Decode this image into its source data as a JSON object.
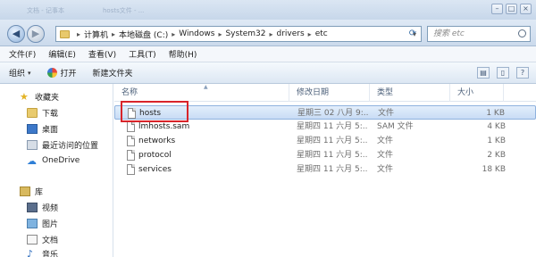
{
  "titlebar": {
    "ghost_tab_1": "文档 - 记事本",
    "ghost_tab_2": "hosts文件 - ...",
    "controls": [
      "–",
      "□",
      "×"
    ]
  },
  "address": {
    "back_icon": "back-arrow-icon",
    "forward_icon": "forward-arrow-icon",
    "crumbs": [
      "计算机",
      "本地磁盘 (C:)",
      "Windows",
      "System32",
      "drivers",
      "etc"
    ],
    "search_placeholder": "搜索 etc"
  },
  "menubar": {
    "items": [
      "文件(F)",
      "编辑(E)",
      "查看(V)",
      "工具(T)",
      "帮助(H)"
    ]
  },
  "toolbar": {
    "organize": "组织",
    "open": "打开",
    "new_folder": "新建文件夹"
  },
  "nav": {
    "favorites": "收藏夹",
    "downloads": "下载",
    "desktop": "桌面",
    "recent": "最近访问的位置",
    "onedrive": "OneDrive",
    "libraries": "库",
    "video": "视频",
    "pictures": "图片",
    "documents": "文档",
    "music": "音乐"
  },
  "columns": {
    "name": "名称",
    "modified": "修改日期",
    "type": "类型",
    "size": "大小"
  },
  "files": [
    {
      "name": "hosts",
      "modified": "星期三 02 八月 9:...",
      "type": "文件",
      "size": "1 KB"
    },
    {
      "name": "lmhosts.sam",
      "modified": "星期四 11 六月 5:...",
      "type": "SAM 文件",
      "size": "4 KB"
    },
    {
      "name": "networks",
      "modified": "星期四 11 六月 5:...",
      "type": "文件",
      "size": "1 KB"
    },
    {
      "name": "protocol",
      "modified": "星期四 11 六月 5:...",
      "type": "文件",
      "size": "2 KB"
    },
    {
      "name": "services",
      "modified": "星期四 11 六月 5:...",
      "type": "文件",
      "size": "18 KB"
    }
  ],
  "colors": {
    "selection": "#c8dcf5",
    "highlight_border": "#d8242a"
  }
}
